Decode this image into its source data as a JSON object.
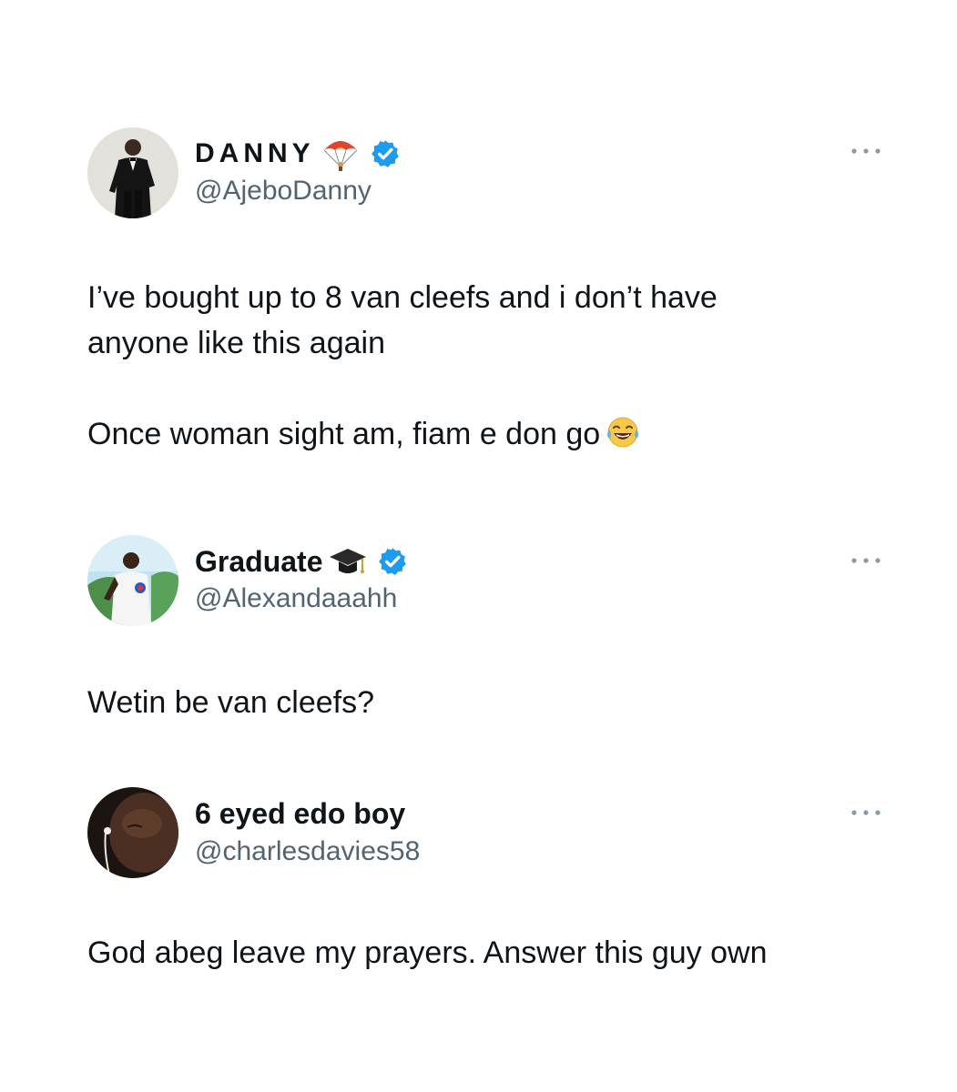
{
  "tweets": [
    {
      "display_name": "DANNY",
      "name_emoji": "parachute-icon",
      "verified": true,
      "handle": "@AjeboDanny",
      "text_lines": [
        "I’ve bought up to 8 van cleefs and i don’t have anyone like this again",
        "Once woman sight am, fiam e don go"
      ],
      "trailing_emoji": "face-with-tears-of-joy-icon"
    },
    {
      "display_name": "Graduate",
      "name_emoji": "graduation-cap-icon",
      "verified": true,
      "handle": "@Alexandaaahh",
      "text_lines": [
        "Wetin be van cleefs?"
      ]
    },
    {
      "display_name": "6 eyed edo boy",
      "verified": false,
      "handle": "@charlesdavies58",
      "text_lines": [
        "God abeg leave my prayers. Answer this guy own"
      ]
    }
  ],
  "colors": {
    "text": "#0f1419",
    "handle": "#536471",
    "verified": "#1d9bf0",
    "background": "#ffffff"
  }
}
